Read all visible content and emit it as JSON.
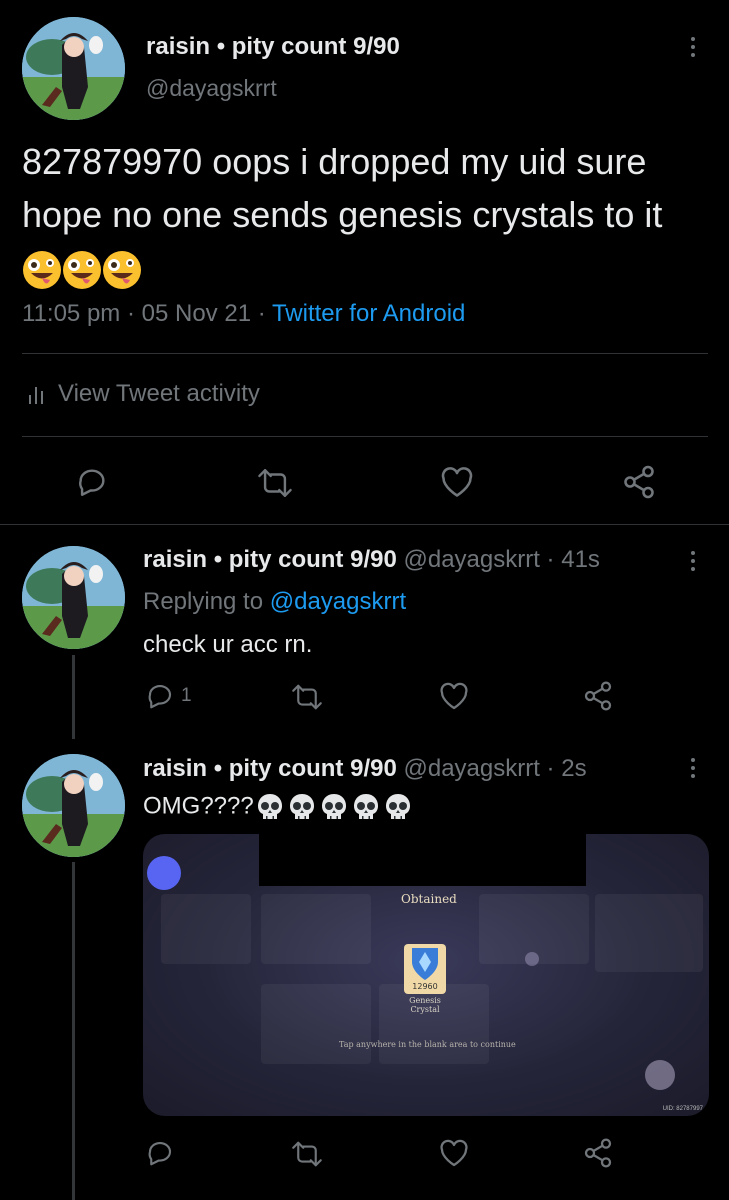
{
  "main_tweet": {
    "display_name": "raisin • pity count 9/90",
    "handle": "@dayagskrrt",
    "text": "827879970 oops i dropped my uid sure hope no one sends genesis crystals to it",
    "emoji": [
      "zany-face",
      "zany-face",
      "zany-face"
    ],
    "time": "11:05 pm",
    "date": "05 Nov 21",
    "source": "Twitter for Android",
    "activity_label": "View Tweet activity"
  },
  "reply_1": {
    "display_name": "raisin • pity count 9/90",
    "handle": "@dayagskrrt",
    "age": "41s",
    "replying_prefix": "Replying to",
    "replying_to": "@dayagskrrt",
    "text": "check ur acc rn.",
    "reply_count": "1"
  },
  "reply_2": {
    "display_name": "raisin • pity count 9/90",
    "handle": "@dayagskrrt",
    "age": "2s",
    "text": "OMG????",
    "emoji": [
      "skull",
      "skull",
      "skull",
      "skull",
      "skull"
    ],
    "media": {
      "obtained_label": "Obtained",
      "item_count": "12960",
      "item_name": "Genesis Crystal",
      "tap_hint": "Tap anywhere in the blank area to continue",
      "uid_watermark": "UID: 82787997"
    }
  },
  "colors": {
    "background": "#000000",
    "text": "#e7e9ea",
    "muted": "#71767b",
    "link": "#1d9bf0",
    "divider": "#2f3336"
  },
  "icons": [
    "reply-icon",
    "retweet-icon",
    "like-icon",
    "share-icon",
    "more-icon",
    "analytics-icon"
  ]
}
